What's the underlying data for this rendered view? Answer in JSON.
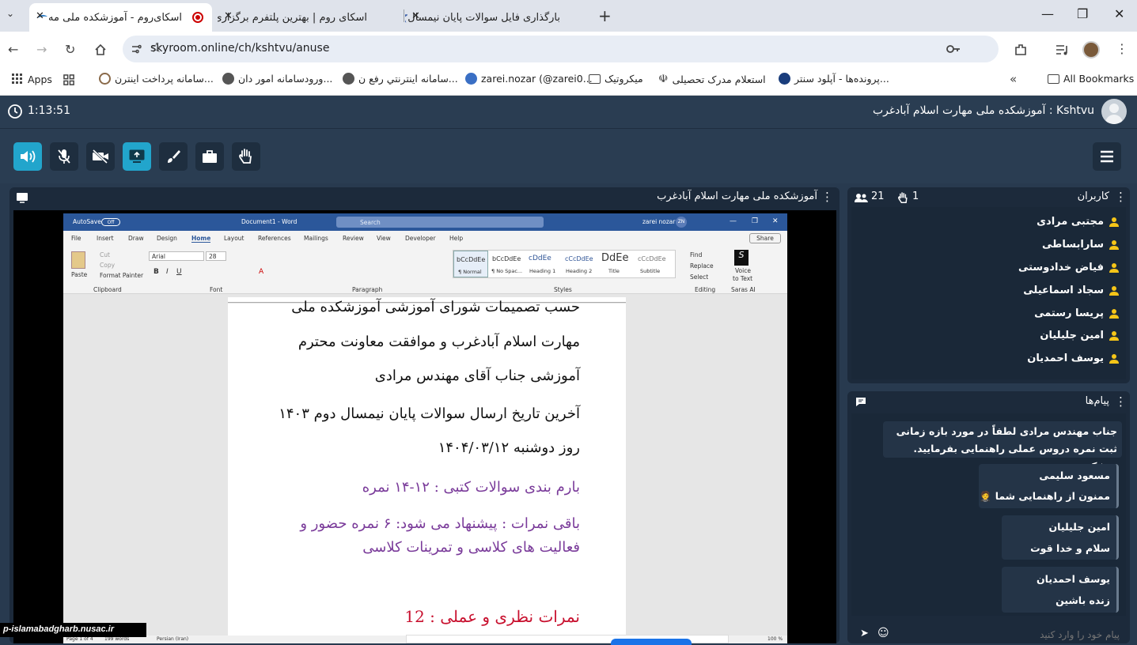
{
  "browser": {
    "tabs": [
      {
        "title": "اسکای‌روم - آموزشکده ملی مه",
        "active": true
      },
      {
        "title": "اسکای روم | بهترین پلتفرم برگزاری",
        "active": false
      },
      {
        "title": "بارگذاری فایل سوالات پایان نیمسال",
        "active": false
      }
    ],
    "new_tab": "+",
    "url": "skyroom.online/ch/kshtvu/anuse",
    "bookmarks": [
      "Apps",
      "سامانه پرداخت اینترن...",
      "ورودسامانه امور دان...",
      "سامانه اینترنتي رفع ن...",
      "zarei.nozar (@zarei0...",
      "میکروتیک",
      "استعلام مدرک تحصیلی",
      "پرونده‌ها - آپلود سنتر...",
      "All Bookmarks"
    ]
  },
  "app": {
    "timer": "1:13:51",
    "room_title": "Kshtvu : آموزشکده ملی مهارت اسلام آبادغرب",
    "stage_title": "آموزشکده ملی مهارت اسلام آبادغرب",
    "watermark": "p-islamabadgharb.nusac.ir",
    "users_panel": {
      "title": "کاربران",
      "count": "21",
      "hands": "1",
      "users": [
        "مجتبی مرادی",
        "سارابساطی",
        "فیاض خدادوستی",
        "سجاد اسماعیلی",
        "پریسا رستمی",
        "امین جلیلیان",
        "یوسف احمدیان"
      ]
    },
    "messages_panel": {
      "title": "پیام‌ها",
      "placeholder": "پیام خود را وارد کنید",
      "messages": [
        {
          "sender": "",
          "text": "جناب مهندس مرادی لطفاً در مورد بازه زمانی ثبت نمره دروس عملی راهنمایی بفرمایید. متشکرم"
        },
        {
          "sender": "مسعود سلیمی",
          "text": "ممنون از راهنمایی شما 🤵"
        },
        {
          "sender": "امین جلیلیان",
          "text": "سلام و خدا قوت"
        },
        {
          "sender": "یوسف احمدیان",
          "text": "زنده باشین"
        }
      ]
    }
  },
  "word": {
    "autosave": "AutoSave",
    "doc_name": "Document1 - Word",
    "search": "Search",
    "user": "zarei nozar",
    "initials": "ZN",
    "share": "Share",
    "menu": [
      "File",
      "Insert",
      "Draw",
      "Design",
      "Home",
      "Layout",
      "References",
      "Mailings",
      "Review",
      "View",
      "Developer",
      "Help"
    ],
    "font": "Arial",
    "size": "28",
    "clip": [
      "Cut",
      "Copy",
      "Format Painter"
    ],
    "paste": "Paste",
    "styles": [
      {
        "sample": "bCcDdEe",
        "name": "¶ Normal"
      },
      {
        "sample": "bCcDdEe",
        "name": "¶ No Spac..."
      },
      {
        "sample": "cDdEe",
        "name": "Heading 1"
      },
      {
        "sample": "cCcDdEe",
        "name": "Heading 2"
      },
      {
        "sample": "DdEe",
        "name": "Title"
      },
      {
        "sample": "cCcDdEe",
        "name": "Subtitle"
      }
    ],
    "editing": [
      "Find",
      "Replace",
      "Select"
    ],
    "voice": [
      "Voice",
      "to Text"
    ],
    "groups": [
      "Clipboard",
      "Font",
      "Paragraph",
      "Styles",
      "Editing",
      "Saras AI"
    ],
    "status": [
      "Page 1 of 4",
      "199 words",
      "Persian (Iran)",
      "100 %"
    ],
    "lines": [
      {
        "text": "حسب تصمیمات شورای آموزشی آموزشکده ملی",
        "color": "#111"
      },
      {
        "text": "مهارت  اسلام آبادغرب و موافقت معاونت محترم",
        "color": "#111"
      },
      {
        "text": "آموزشی جناب آقای مهندس مرادی",
        "color": "#111"
      },
      {
        "text": "آخرین تاریخ ارسال سوالات پایان نیمسال دوم ۱۴۰۳",
        "color": "#111"
      },
      {
        "text": "روز دوشنبه ۱۴۰۴/۰۳/۱۲",
        "color": "#111"
      },
      {
        "text": "بارم بندی سوالات کتبی :  ۱۲-۱۴ نمره",
        "color": "#7a3b9a"
      },
      {
        "text": "باقی نمرات : پیشنهاد می شود: ۶ نمره حضور و",
        "color": "#7a3b9a"
      },
      {
        "text": "فعالیت های کلاسی و تمرینات کلاسی",
        "color": "#7a3b9a"
      },
      {
        "text": "نمرات نظری و عملی :  12",
        "color": "#c8102e"
      }
    ]
  },
  "colors": {
    "accent": "#22a5cc",
    "bg": "#283a4f",
    "panel": "#1c2a3b"
  }
}
